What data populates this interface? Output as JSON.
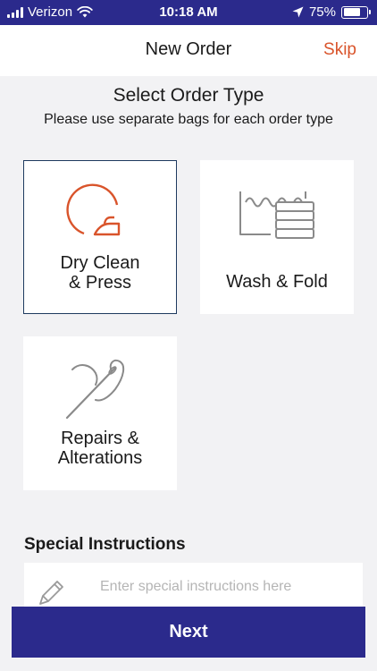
{
  "status_bar": {
    "carrier": "Verizon",
    "time": "10:18 AM",
    "battery_percent": "75%",
    "battery_level": 0.75,
    "icons": [
      "signal-icon",
      "wifi-icon",
      "location-arrow-icon",
      "battery-icon"
    ]
  },
  "header": {
    "title": "New Order",
    "skip_label": "Skip"
  },
  "order_type": {
    "title": "Select Order Type",
    "subtitle": "Please use separate bags for each order type",
    "options": [
      {
        "line1": "Dry Clean",
        "line2": "& Press",
        "icon": "dry-clean-icon",
        "selected": true
      },
      {
        "line1": "Wash & Fold",
        "line2": "",
        "icon": "wash-fold-icon",
        "selected": false
      },
      {
        "line1": "Repairs &",
        "line2": "Alterations",
        "icon": "needle-thread-icon",
        "selected": false
      }
    ]
  },
  "special_instructions": {
    "title": "Special Instructions",
    "placeholder": "Enter special instructions here",
    "value": ""
  },
  "footer": {
    "next_label": "Next"
  },
  "colors": {
    "brand": "#2b2a8c",
    "accent": "#d9542b",
    "selected_border": "#1e3a5f",
    "background": "#f2f2f4",
    "icon_gray": "#8a8a8a"
  }
}
